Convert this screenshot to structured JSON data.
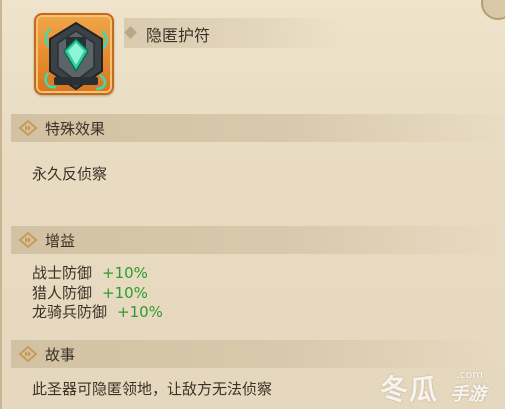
{
  "item": {
    "name": "隐匿护符",
    "icon": "amulet-icon",
    "rarity_color": "#e5892c"
  },
  "sections": {
    "special_effect": {
      "title": "特殊效果",
      "text": "永久反侦察"
    },
    "bonus": {
      "title": "增益",
      "rows": [
        {
          "label": "战士防御",
          "value": "+10%"
        },
        {
          "label": "猎人防御",
          "value": "+10%"
        },
        {
          "label": "龙骑兵防御",
          "value": "+10%"
        }
      ]
    },
    "story": {
      "title": "故事",
      "text": "此圣器可隐匿领地，让敌方无法侦察"
    }
  },
  "colors": {
    "bonus_value": "#2e9b2e",
    "background": "#e9dcc4"
  },
  "watermark": {
    "main": "冬瓜",
    "sub_top": ".com",
    "sub_bottom": "手游"
  }
}
